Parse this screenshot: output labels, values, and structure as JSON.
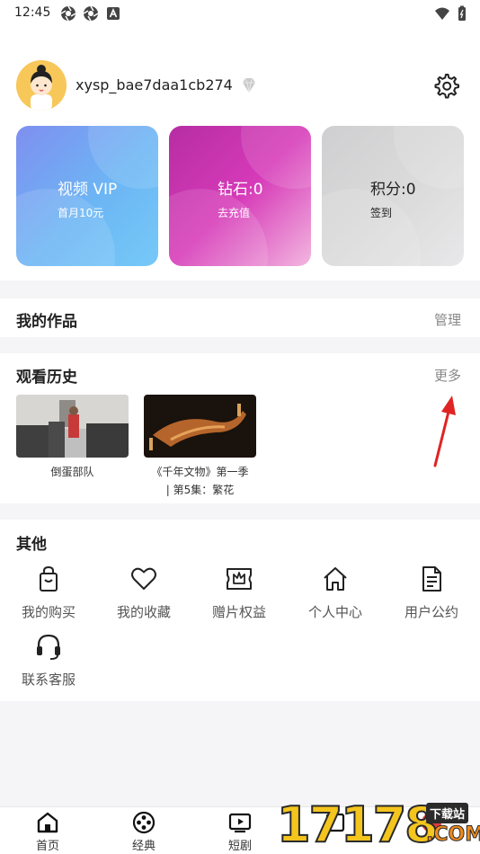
{
  "status_bar": {
    "time": "12:45"
  },
  "profile": {
    "username": "xysp_bae7daa1cb274"
  },
  "cards": [
    {
      "title": "视频 VIP",
      "subtitle": "首月10元"
    },
    {
      "title": "钻石:0",
      "subtitle": "去充值"
    },
    {
      "title": "积分:0",
      "subtitle": "签到"
    }
  ],
  "works": {
    "title": "我的作品",
    "action": "管理"
  },
  "history": {
    "title": "观看历史",
    "action": "更多",
    "items": [
      {
        "line1": "倒蛋部队",
        "line2": ""
      },
      {
        "line1": "《千年文物》第一季",
        "line2": "| 第5集：繁花"
      }
    ]
  },
  "others": {
    "title": "其他",
    "items": [
      {
        "label": "我的购买",
        "icon": "shopping-bag-icon"
      },
      {
        "label": "我的收藏",
        "icon": "heart-icon"
      },
      {
        "label": "赠片权益",
        "icon": "crown-ticket-icon"
      },
      {
        "label": "个人中心",
        "icon": "home-icon"
      },
      {
        "label": "用户公约",
        "icon": "document-icon"
      },
      {
        "label": "联系客服",
        "icon": "headset-icon"
      }
    ]
  },
  "tabbar": {
    "items": [
      {
        "label": "首页",
        "icon": "home-icon"
      },
      {
        "label": "经典",
        "icon": "film-reel-icon"
      },
      {
        "label": "短剧",
        "icon": "play-screen-icon"
      },
      {
        "label": "",
        "icon": "grid-icon"
      },
      {
        "label": "",
        "icon": "profile-icon"
      }
    ]
  },
  "watermark": {
    "number": "17178",
    "badge": "下载站",
    "domain": ".COM"
  },
  "colors": {
    "vip_card": "#6cb6f4",
    "diamond_card": "#d63ab8",
    "points_card": "#dcdcdc",
    "annotation_arrow": "#e02424"
  }
}
